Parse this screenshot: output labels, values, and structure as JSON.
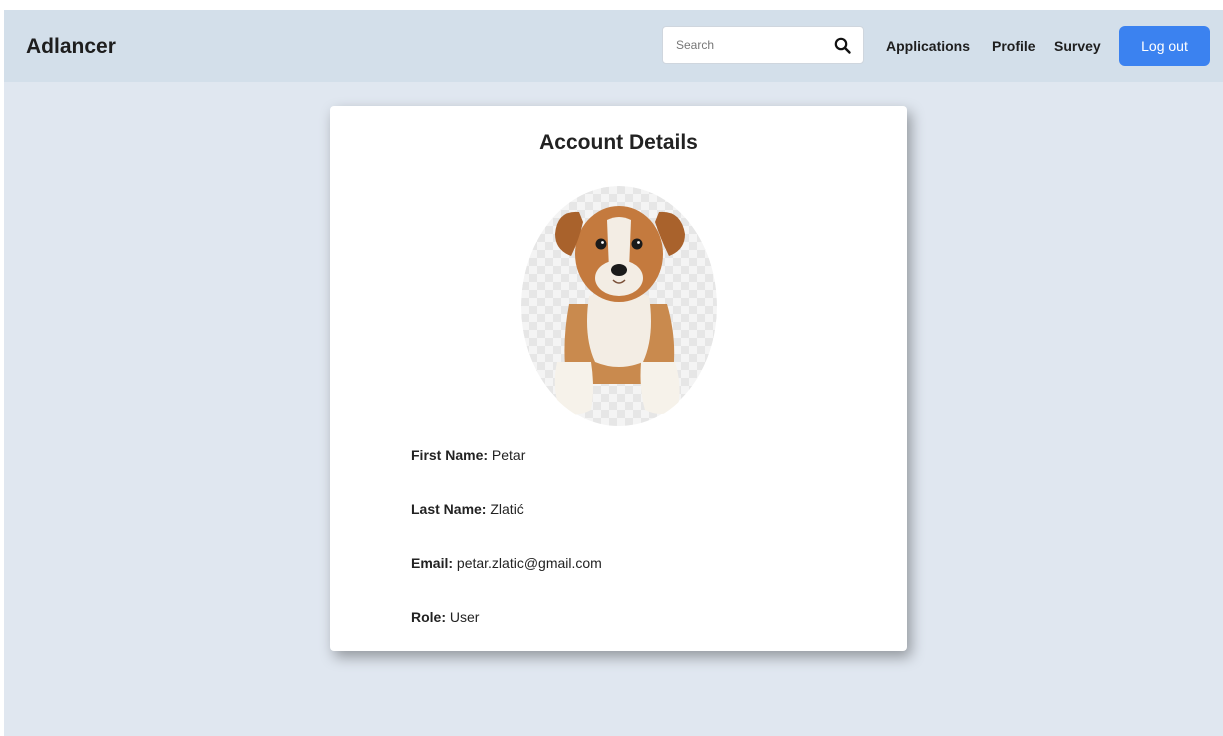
{
  "header": {
    "brand": "Adlancer",
    "search_placeholder": "Search",
    "nav": {
      "applications": "Applications",
      "profile": "Profile",
      "survey": "Survey"
    },
    "logout_label": "Log out"
  },
  "account": {
    "title": "Account Details",
    "avatar_icon": "puppy-avatar-icon",
    "fields": [
      {
        "label": "First Name:",
        "value": "Petar"
      },
      {
        "label": "Last Name:",
        "value": "Zlatić"
      },
      {
        "label": "Email:",
        "value": "petar.zlatic@gmail.com"
      },
      {
        "label": "Role:",
        "value": "User"
      }
    ]
  },
  "colors": {
    "navbar_bg": "#d3dfea",
    "page_bg": "#e0e7f0",
    "logout_button": "#3b82f0"
  }
}
